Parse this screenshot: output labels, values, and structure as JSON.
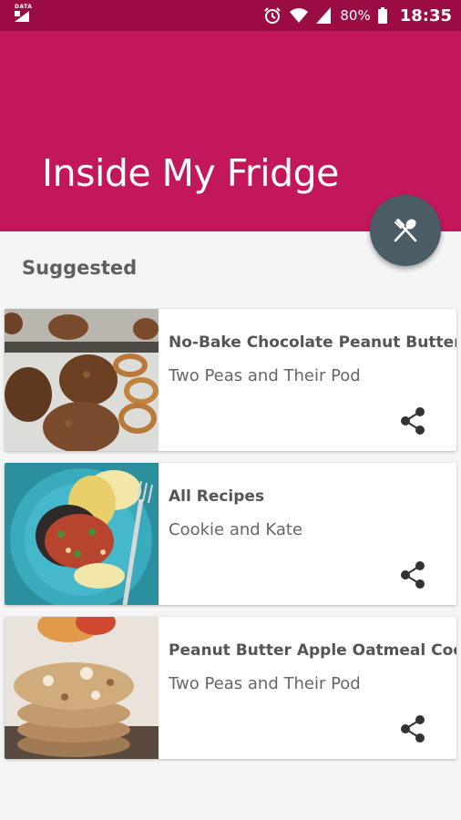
{
  "status_bar": {
    "data_label": "DATA",
    "battery": "80%",
    "time": "18:35",
    "icons": [
      "alarm-icon",
      "wifi-icon",
      "signal-icon",
      "battery-icon"
    ]
  },
  "app_bar": {
    "title": "Inside My Fridge",
    "color": "#c2185b",
    "status_color": "#9c0c44"
  },
  "fab": {
    "icon": "fork-spoon-icon",
    "color": "#4a5c66"
  },
  "section": {
    "title": "Suggested"
  },
  "recipes": [
    {
      "title": "No-Bake Chocolate Peanut Butter P",
      "source": "Two Peas and Their Pod",
      "image": "no-bake-cookies-photo"
    },
    {
      "title": "All Recipes",
      "source": "Cookie and Kate",
      "image": "salsa-plate-photo"
    },
    {
      "title": "Peanut Butter Apple Oatmeal Cookie",
      "source": "Two Peas and Their Pod",
      "image": "oatmeal-cookies-photo"
    }
  ]
}
